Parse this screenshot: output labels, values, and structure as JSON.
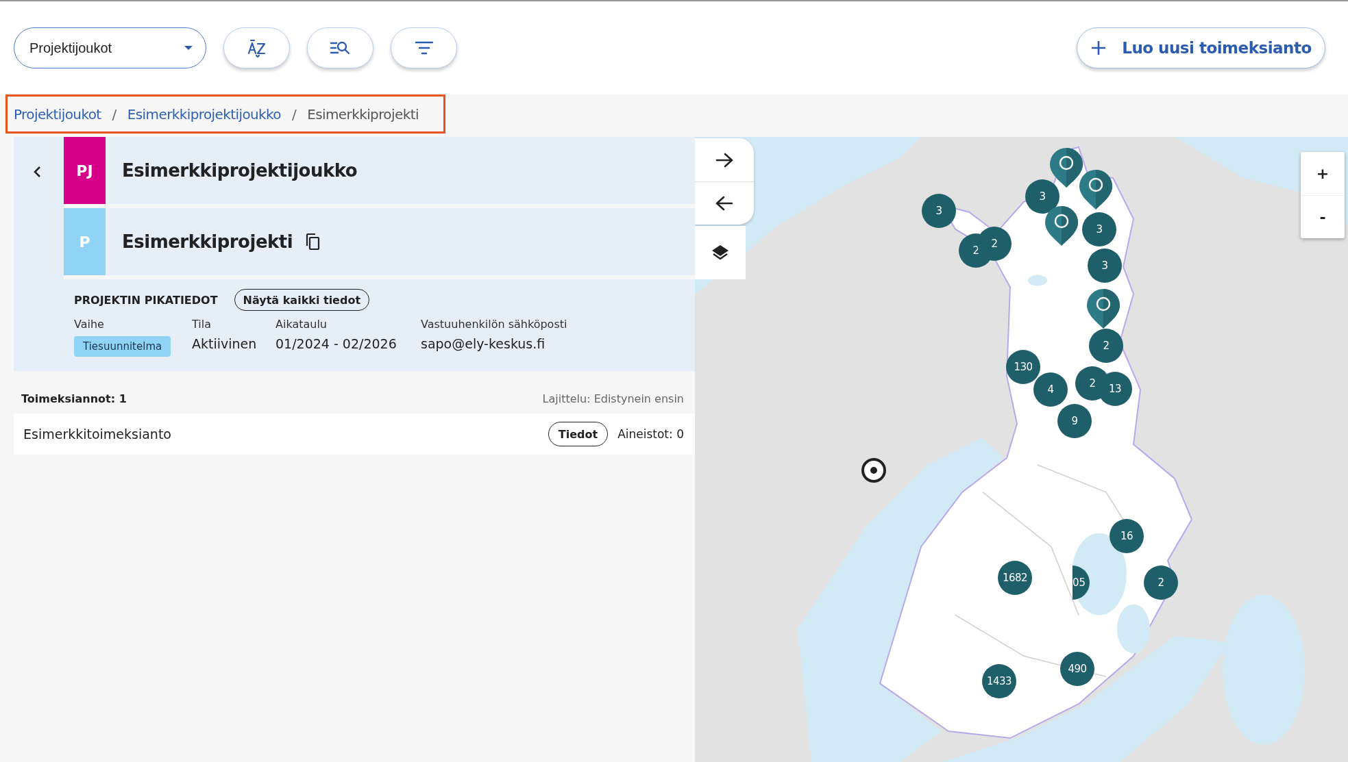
{
  "toolbar": {
    "group_select": {
      "value": "Projektijoukot"
    },
    "icon_buttons": [
      {
        "kind": "sort"
      },
      {
        "kind": "search"
      },
      {
        "kind": "filter"
      }
    ],
    "create_button": {
      "label": "Luo uusi toimeksianto"
    }
  },
  "breadcrumb": [
    {
      "label": "Projektijoukot",
      "current": false
    },
    {
      "label": "/",
      "kind": "separator"
    },
    {
      "label": "Esimerkkiprojektijoukko",
      "current": false
    },
    {
      "label": "/",
      "kind": "separator"
    },
    {
      "label": "Esimerkkiprojekti",
      "current": true
    }
  ],
  "project_group": {
    "badge": "PJ",
    "name": "Esimerkkiprojektijoukko"
  },
  "project": {
    "badge": "P",
    "name": "Esimerkkiprojekti"
  },
  "quick_info": {
    "title": "PROJEKTIN PIKATIEDOT",
    "show_all_button": "Näytä kaikki tiedot",
    "fields": [
      {
        "label": "Vaihe",
        "value": "Tiesuunnitelma",
        "kind": "tag"
      },
      {
        "label": "Tila",
        "value": "Aktiivinen",
        "kind": "text"
      },
      {
        "label": "Aikataulu",
        "value": "01/2024 - 02/2026",
        "kind": "text"
      },
      {
        "label": "Vastuuhenkilön sähköposti",
        "value": "sapo@ely-keskus.fi",
        "kind": "text"
      }
    ]
  },
  "assignments": {
    "count_label": "Toimeksiannot: 1",
    "sort_label": "Lajittelu: Edistynein ensin",
    "items": [
      {
        "name": "Esimerkkitoimeksianto",
        "details_button": "Tiedot",
        "materials": "Aineistot: 0"
      }
    ]
  },
  "map": {
    "zoom_in": "+",
    "zoom_out": "-",
    "markers": [
      {
        "kind": "pin"
      },
      {
        "kind": "pin"
      },
      {
        "kind": "cluster",
        "count": "3"
      },
      {
        "kind": "cluster",
        "count": "3"
      },
      {
        "kind": "cluster",
        "count": "2"
      },
      {
        "kind": "cluster",
        "count": "2"
      },
      {
        "kind": "pin"
      },
      {
        "kind": "cluster",
        "count": "3"
      },
      {
        "kind": "cluster",
        "count": "3"
      },
      {
        "kind": "pin"
      },
      {
        "kind": "cluster",
        "count": "2"
      },
      {
        "kind": "cluster",
        "count": "130"
      },
      {
        "kind": "cluster",
        "count": "4"
      },
      {
        "kind": "cluster",
        "count": "2"
      },
      {
        "kind": "cluster",
        "count": "13"
      },
      {
        "kind": "cluster",
        "count": "9"
      },
      {
        "kind": "cluster",
        "count": "16"
      },
      {
        "kind": "cluster",
        "count": "1682"
      },
      {
        "kind": "partial",
        "count": "05"
      },
      {
        "kind": "cluster",
        "count": "2"
      },
      {
        "kind": "cluster",
        "count": "490"
      },
      {
        "kind": "cluster",
        "count": "1433"
      }
    ]
  }
}
